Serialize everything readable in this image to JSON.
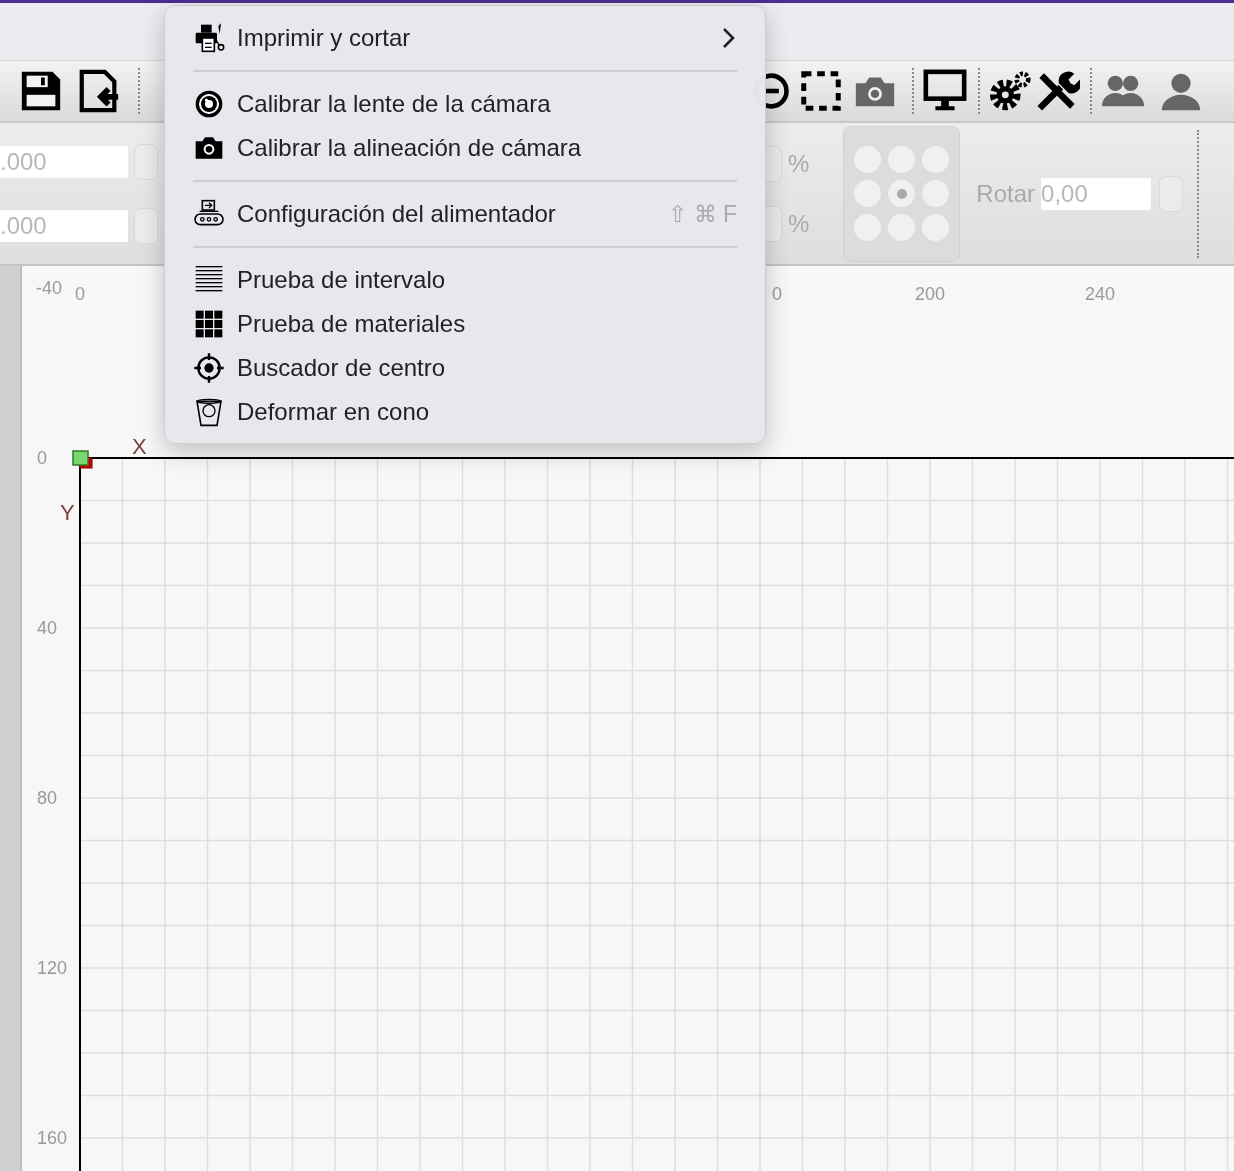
{
  "properties": {
    "position_fields": [
      {
        "value": ".000"
      },
      {
        "value": ".000"
      }
    ],
    "scale_units": [
      "%",
      "%"
    ],
    "anchor_points": [
      {
        "selected": false
      },
      {
        "selected": false
      },
      {
        "selected": false
      },
      {
        "selected": false
      },
      {
        "selected": true
      },
      {
        "selected": false
      },
      {
        "selected": false
      },
      {
        "selected": false
      },
      {
        "selected": false
      }
    ],
    "rotate": {
      "label": "Rotar",
      "value": "0,00"
    }
  },
  "canvas": {
    "x_ruler": [
      "0",
      "0",
      "200",
      "240"
    ],
    "y_ruler": [
      "-40",
      "0",
      "40",
      "80",
      "120",
      "160"
    ],
    "x_axis_label": "X",
    "y_axis_label": "Y"
  },
  "menu": {
    "sections": [
      [
        {
          "label": "Imprimir y cortar",
          "submenu": true
        }
      ],
      [
        {
          "label": "Calibrar la lente de la cámara",
          "submenu": false
        },
        {
          "label": "Calibrar la alineación de cámara",
          "submenu": false
        }
      ],
      [
        {
          "label": "Configuración del alimentador",
          "submenu": false,
          "shortcut": "⇧ ⌘ F"
        }
      ],
      [
        {
          "label": "Prueba de intervalo",
          "submenu": false
        },
        {
          "label": "Prueba de materiales",
          "submenu": false
        },
        {
          "label": "Buscador de centro",
          "submenu": false
        },
        {
          "label": "Deformar en cono",
          "submenu": false
        }
      ]
    ]
  }
}
